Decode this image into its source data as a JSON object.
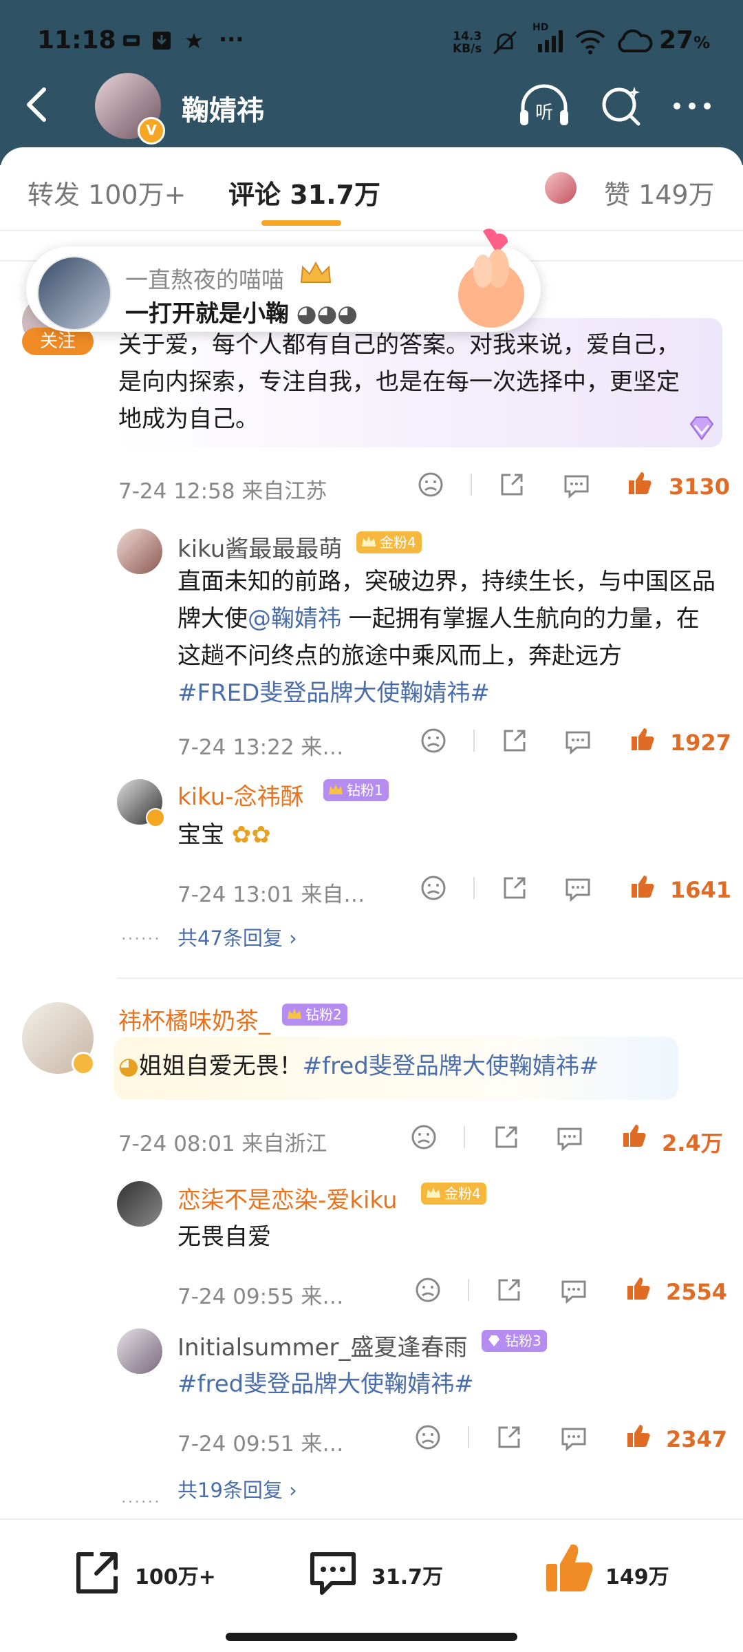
{
  "status_bar": {
    "time": "11:18",
    "net_speed_value": "14.3",
    "net_speed_unit": "KB/s",
    "hd_label": "HD",
    "battery": "27",
    "battery_unit": "%"
  },
  "header": {
    "title": "鞠婧祎"
  },
  "tabs": {
    "repost": "转发 100万+",
    "comments": "评论 31.7万",
    "likes": "赞 149万"
  },
  "toast": {
    "user": "一直熬夜的喵喵",
    "message": "一打开就是小鞠"
  },
  "follow_label": "关注",
  "comments": [
    {
      "text": "关于爱，每个人都有自己的答案。对我来说，爱自己，是向内探索，专注自我，也是在每一次选择中，更坚定地成为自己。",
      "meta": "7-24 12:58  来自江苏",
      "likes": "3130",
      "replies": [
        {
          "user": "kiku酱最最最萌",
          "badge": "金粉4",
          "text_pre": "直面未知的前路，突破边界，持续生长，与中国区品牌大使",
          "mention": "@鞠婧祎",
          "text_post": " 一起拥有掌握人生航向的力量，在这趟不问终点的旅途中乘风而上，奔赴远方",
          "hashtag": "#FRED斐登品牌大使鞠婧祎#",
          "meta": "7-24 13:22  来…",
          "likes": "1927"
        },
        {
          "user": "kiku-念祎酥",
          "badge": "钻粉1",
          "text": "宝宝",
          "meta": "7-24 13:01  来自…",
          "likes": "1641"
        }
      ],
      "more": "共47条回复"
    },
    {
      "user": "祎杯橘味奶茶_",
      "badge": "钻粉2",
      "text_pre": "姐姐自爱无畏！",
      "hashtag": "#fred斐登品牌大使鞠婧祎#",
      "meta": "7-24 08:01  来自浙江",
      "likes": "2.4万",
      "replies": [
        {
          "user": "恋柒不是恋染-爱kiku",
          "badge": "金粉4",
          "text": "无畏自爱",
          "meta": "7-24 09:55  来…",
          "likes": "2554"
        },
        {
          "user": "Initialsummer_盛夏逢春雨",
          "badge": "钻粉3",
          "hashtag": "#fred斐登品牌大使鞠婧祎#",
          "meta": "7-24 09:51  来…",
          "likes": "2347"
        }
      ],
      "more": "共19条回复"
    }
  ],
  "bottom_bar": {
    "repost": "100万+",
    "comments": "31.7万",
    "likes": "149万"
  },
  "colors": {
    "header_bg": "#2f5264",
    "accent_orange": "#e8731c",
    "link_blue": "#4a6dab",
    "gold_badge": "#f5b83d",
    "diamond_badge": "#b58cf0"
  }
}
